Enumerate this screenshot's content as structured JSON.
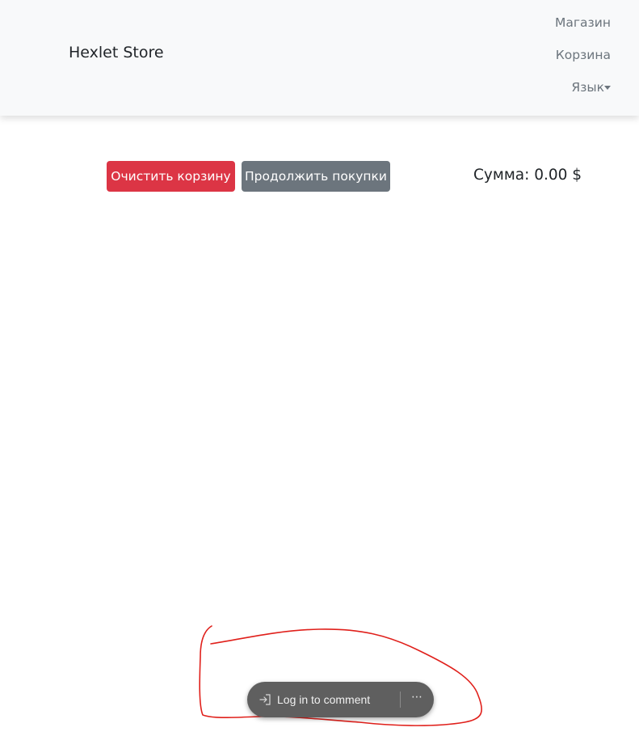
{
  "navbar": {
    "brand": "Hexlet Store",
    "links": {
      "shop": "Магазин",
      "cart": "Корзина",
      "language": "Язык"
    }
  },
  "cart": {
    "clear_label": "Очистить корзину",
    "continue_label": "Продолжить покупки",
    "total": "Сумма: 0.00 $"
  },
  "comment_toolbar": {
    "login_label": "Log in to comment",
    "login_icon": "sign-in-icon",
    "more_icon": "more-horizontal-icon"
  },
  "colors": {
    "navbar_bg": "#f8f9fa",
    "danger": "#dc3545",
    "secondary": "#6c757d",
    "annotation": "#e0201b"
  }
}
